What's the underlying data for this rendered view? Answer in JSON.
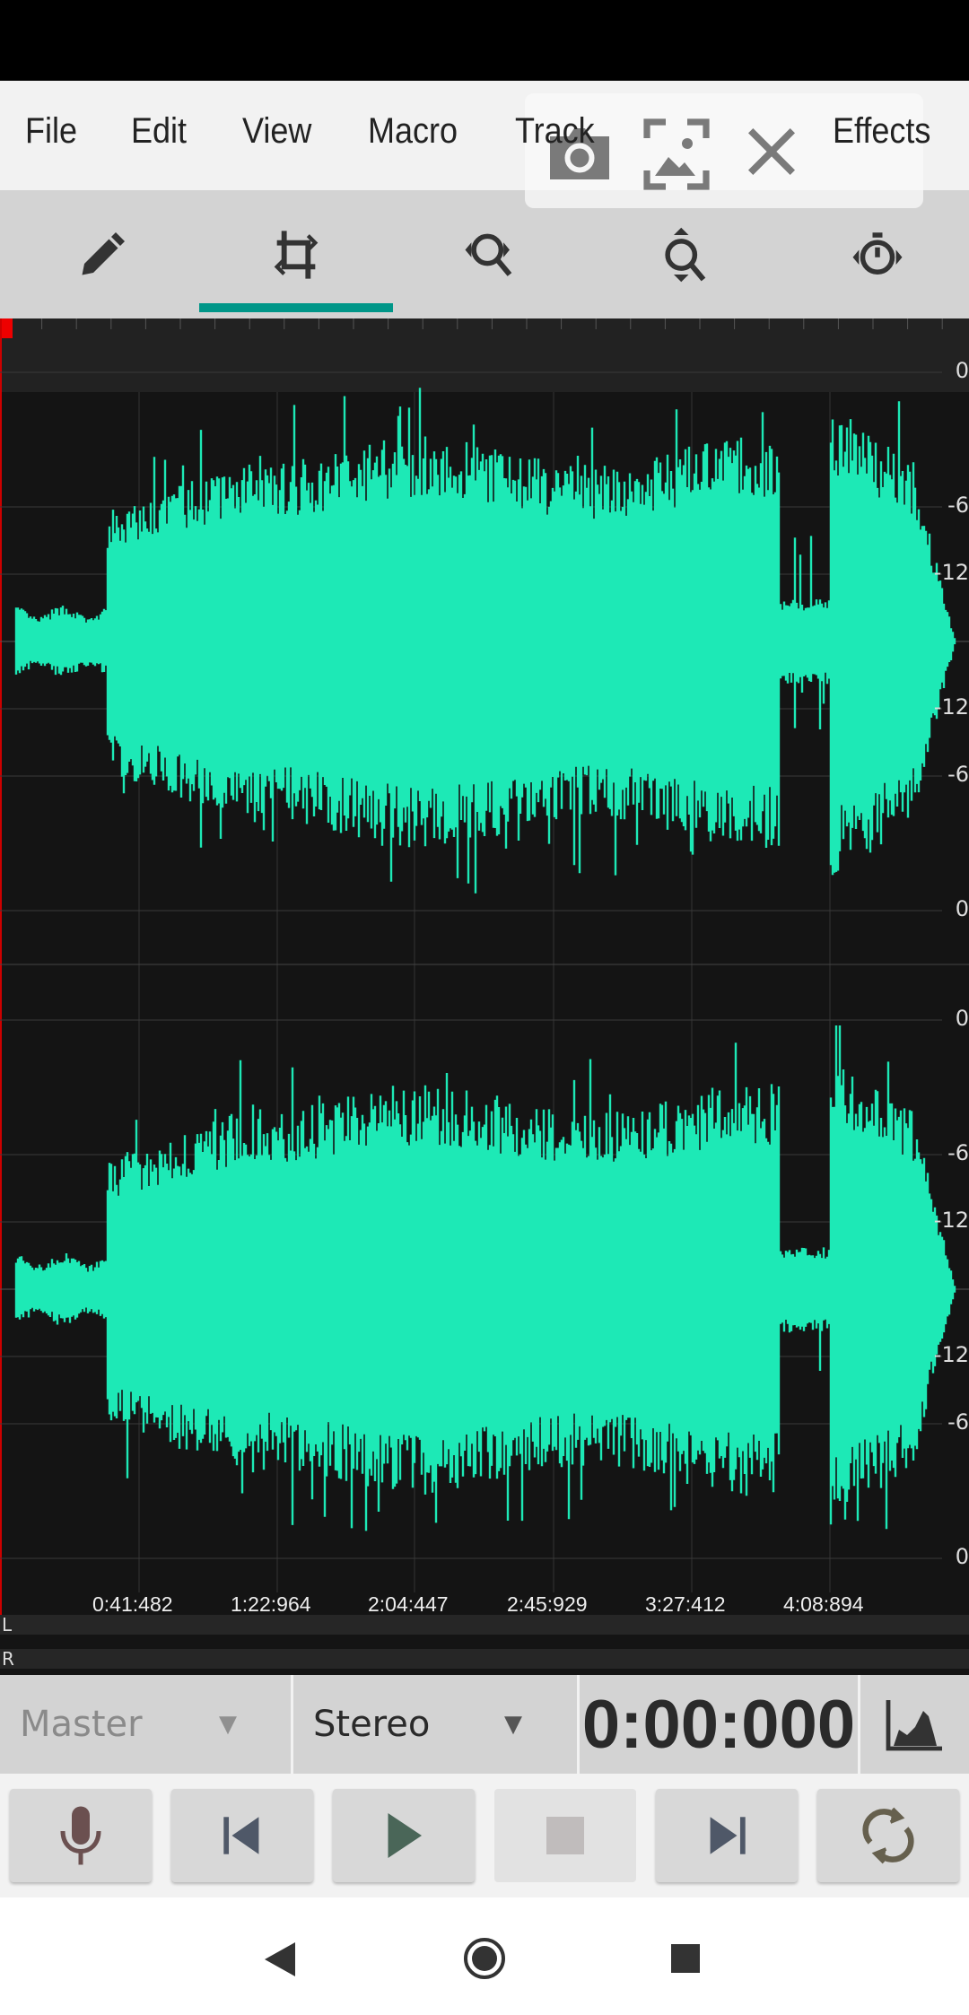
{
  "menu": {
    "items": [
      "File",
      "Edit",
      "View",
      "Macro",
      "Track",
      "Effects"
    ]
  },
  "toolbar": {
    "tools": [
      "pencil-icon",
      "crop-select-icon",
      "zoom-horizontal-icon",
      "zoom-vertical-icon",
      "timer-icon"
    ],
    "active_index": 1
  },
  "screenshot_overlay": {
    "icons": [
      "camera-icon",
      "image-capture-icon",
      "close-icon"
    ]
  },
  "waveform": {
    "color": "#1de9b6",
    "time_labels": [
      "0:41:482",
      "1:22:964",
      "2:04:447",
      "2:45:929",
      "3:27:412",
      "4:08:894"
    ],
    "db_labels": [
      "0",
      "-6",
      "-12",
      "-12",
      "-6",
      "0"
    ],
    "channels": [
      "L",
      "R"
    ]
  },
  "controls": {
    "track": "Master",
    "channel_mode": "Stereo",
    "time": "0:00:000"
  },
  "transport": [
    "record",
    "skip-back",
    "play",
    "stop",
    "skip-forward",
    "loop"
  ],
  "accent": "#009688"
}
